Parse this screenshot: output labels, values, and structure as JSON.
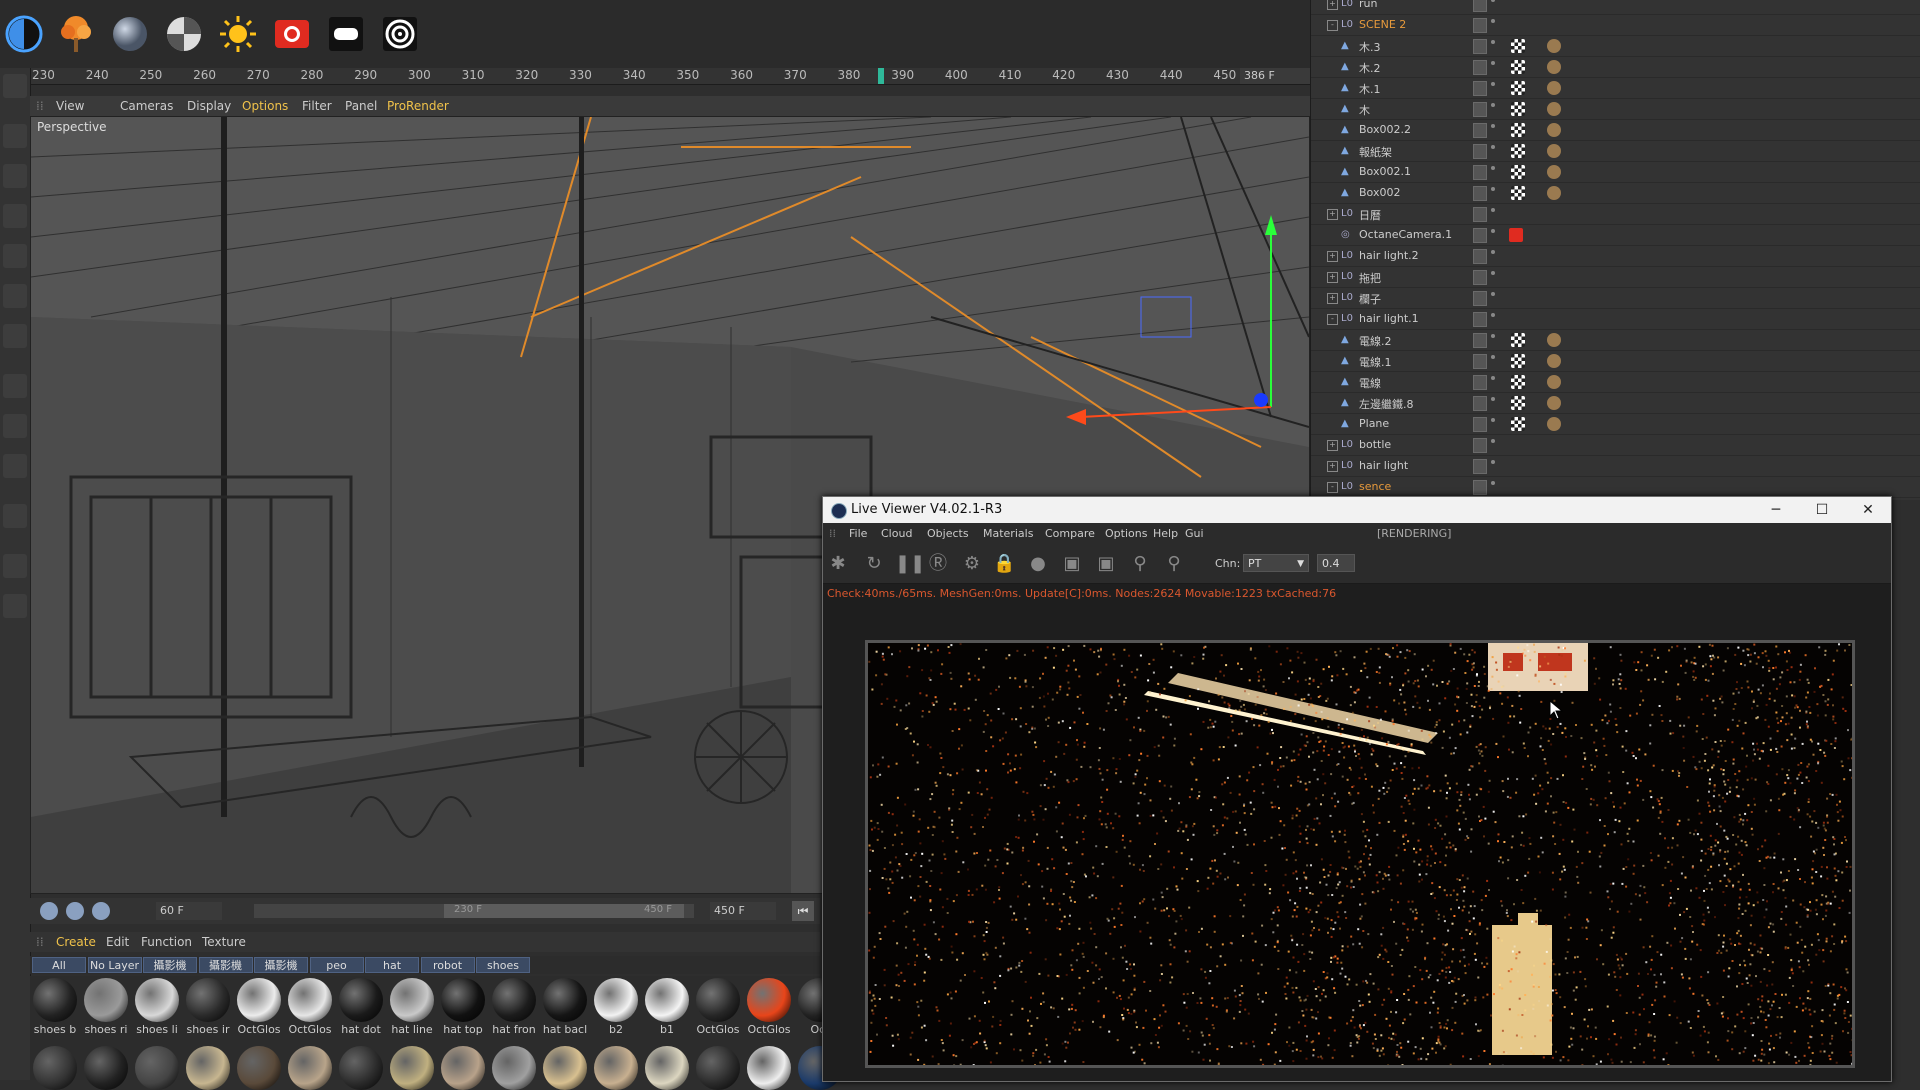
{
  "toolbar": {
    "icons": [
      "half-circle-icon",
      "tree-icon",
      "sphere-icon",
      "checker-sphere-icon",
      "sun-icon",
      "camera-icon",
      "rect-light-icon",
      "target-icon"
    ]
  },
  "timeline": {
    "ticks": [
      "230",
      "240",
      "250",
      "260",
      "270",
      "280",
      "290",
      "300",
      "310",
      "320",
      "330",
      "340",
      "350",
      "360",
      "370",
      "380",
      "390",
      "400",
      "410",
      "420",
      "430",
      "440",
      "450"
    ],
    "current_frame": "386 F"
  },
  "viewport": {
    "menu": [
      "View",
      "Cameras",
      "Display",
      "Options",
      "Filter",
      "Panel",
      "ProRender"
    ],
    "active_menu": "Options",
    "label": "Perspective"
  },
  "anim": {
    "fps_field": "60 F",
    "range_start": "230 F",
    "range_end": "450 F",
    "end_field": "450 F"
  },
  "materials": {
    "menu": [
      "Create",
      "Edit",
      "Function",
      "Texture"
    ],
    "tabs": [
      "All",
      "No Layer",
      "攝影機",
      "攝影機",
      "攝影機",
      "peo",
      "hat",
      "robot",
      "shoes"
    ],
    "items": [
      {
        "label": "shoes b",
        "color": "#222"
      },
      {
        "label": "shoes ri",
        "color": "#9a9a9a"
      },
      {
        "label": "shoes li",
        "color": "#d8d8d8"
      },
      {
        "label": "shoes ir",
        "color": "#2a2a2a"
      },
      {
        "label": "OctGlos",
        "color": "#ececec"
      },
      {
        "label": "OctGlos",
        "color": "#e6e6e6"
      },
      {
        "label": "hat dot",
        "color": "#1a1a1a"
      },
      {
        "label": "hat line",
        "color": "#c9c9c9"
      },
      {
        "label": "hat top",
        "color": "#111"
      },
      {
        "label": "hat fron",
        "color": "#1c1c1c"
      },
      {
        "label": "hat bacl",
        "color": "#151515"
      },
      {
        "label": "b2",
        "color": "#f2f2f2"
      },
      {
        "label": "b1",
        "color": "#f4f4f4"
      },
      {
        "label": "OctGlos",
        "color": "#262626"
      },
      {
        "label": "OctGlos",
        "color": "#e8451a"
      },
      {
        "label": "Oct",
        "color": "#222"
      }
    ]
  },
  "objects": {
    "rows": [
      {
        "name": "run",
        "type": "layer",
        "exp": "+",
        "orange": false
      },
      {
        "name": "SCENE 2",
        "type": "layer",
        "exp": "-",
        "orange": true
      },
      {
        "name": "木.3",
        "type": "obj",
        "exp": "",
        "orange": false
      },
      {
        "name": "木.2",
        "type": "obj",
        "exp": "",
        "orange": false
      },
      {
        "name": "木.1",
        "type": "obj",
        "exp": "",
        "orange": false
      },
      {
        "name": "木",
        "type": "obj",
        "exp": "",
        "orange": false
      },
      {
        "name": "Box002.2",
        "type": "obj",
        "exp": "",
        "orange": false
      },
      {
        "name": "報紙架",
        "type": "obj",
        "exp": "",
        "orange": false
      },
      {
        "name": "Box002.1",
        "type": "obj",
        "exp": "",
        "orange": false
      },
      {
        "name": "Box002",
        "type": "obj",
        "exp": "",
        "orange": false
      },
      {
        "name": "日曆",
        "type": "layer",
        "exp": "+",
        "orange": false
      },
      {
        "name": "OctaneCamera.1",
        "type": "cam",
        "exp": "",
        "orange": false
      },
      {
        "name": "hair light.2",
        "type": "layer",
        "exp": "+",
        "orange": false
      },
      {
        "name": "拖把",
        "type": "layer",
        "exp": "+",
        "orange": false
      },
      {
        "name": "欄子",
        "type": "layer",
        "exp": "+",
        "orange": false
      },
      {
        "name": "hair light.1",
        "type": "layer",
        "exp": "-",
        "orange": false
      },
      {
        "name": "電線.2",
        "type": "obj",
        "exp": "",
        "orange": false
      },
      {
        "name": "電線.1",
        "type": "obj",
        "exp": "",
        "orange": false
      },
      {
        "name": "電線",
        "type": "obj",
        "exp": "",
        "orange": false
      },
      {
        "name": "左邊繼鐵.8",
        "type": "obj",
        "exp": "",
        "orange": false
      },
      {
        "name": "Plane",
        "type": "obj",
        "exp": "",
        "orange": false
      },
      {
        "name": "bottle",
        "type": "layer",
        "exp": "+",
        "orange": false
      },
      {
        "name": "hair light",
        "type": "layer",
        "exp": "+",
        "orange": false
      },
      {
        "name": "sence",
        "type": "layer",
        "exp": "-",
        "orange": true
      }
    ]
  },
  "live_viewer": {
    "title": "Live Viewer V4.02.1-R3",
    "menu": [
      "File",
      "Cloud",
      "Objects",
      "Materials",
      "Compare",
      "Options",
      "Help",
      "Gui"
    ],
    "state": "[RENDERING]",
    "chn_label": "Chn:",
    "chn_value": "PT",
    "value_field": "0.4",
    "status": "Check:40ms./65ms. MeshGen:0ms. Update[C]:0ms. Nodes:2624 Movable:1223 txCached:76",
    "buttons": {
      "minimize": "─",
      "maximize": "☐",
      "close": "✕"
    }
  }
}
